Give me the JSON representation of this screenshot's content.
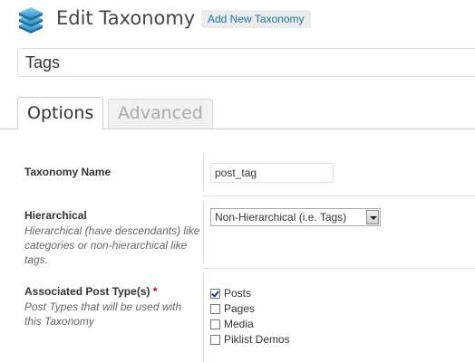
{
  "header": {
    "title": "Edit Taxonomy",
    "add_new_label": "Add New Taxonomy",
    "icon": "stacked-layers-icon"
  },
  "name_field": {
    "value": "Tags"
  },
  "tabs": [
    {
      "label": "Options",
      "active": true
    },
    {
      "label": "Advanced",
      "active": false
    }
  ],
  "fields": {
    "taxonomy_name": {
      "label": "Taxonomy Name",
      "value": "post_tag"
    },
    "hierarchical": {
      "label": "Hierarchical",
      "description": "Hierarchical (have descendants) like categories or non-hierarchical like tags.",
      "selected": "Non-Hierarchical (i.e. Tags)"
    },
    "post_types": {
      "label": "Associated Post Type(s)",
      "required_mark": "*",
      "description": "Post Types that will be used with this Taxonomy",
      "options": [
        {
          "label": "Posts",
          "checked": true
        },
        {
          "label": "Pages",
          "checked": false
        },
        {
          "label": "Media",
          "checked": false
        },
        {
          "label": "Piklist Demos",
          "checked": false
        }
      ]
    }
  },
  "colors": {
    "link": "#21759b",
    "required": "#cc0000",
    "text": "#333333"
  }
}
